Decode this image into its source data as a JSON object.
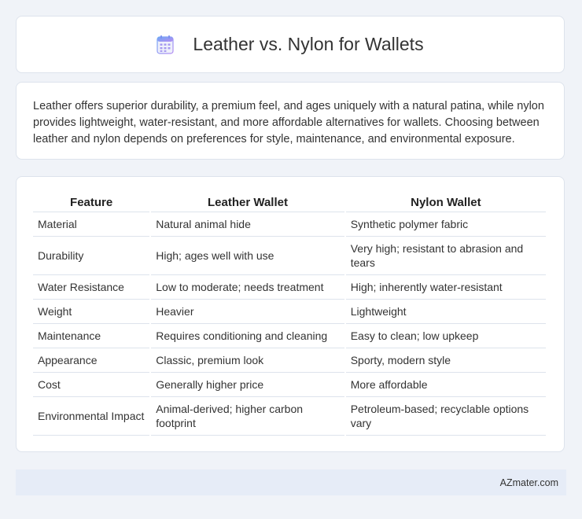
{
  "header": {
    "title": "Leather vs. Nylon for Wallets",
    "icon": "calendar-icon"
  },
  "description": "Leather offers superior durability, a premium feel, and ages uniquely with a natural patina, while nylon provides lightweight, water-resistant, and more affordable alternatives for wallets. Choosing between leather and nylon depends on preferences for style, maintenance, and environmental exposure.",
  "table": {
    "headers": [
      "Feature",
      "Leather Wallet",
      "Nylon Wallet"
    ],
    "rows": [
      [
        "Material",
        "Natural animal hide",
        "Synthetic polymer fabric"
      ],
      [
        "Durability",
        "High; ages well with use",
        "Very high; resistant to abrasion and tears"
      ],
      [
        "Water Resistance",
        "Low to moderate; needs treatment",
        "High; inherently water-resistant"
      ],
      [
        "Weight",
        "Heavier",
        "Lightweight"
      ],
      [
        "Maintenance",
        "Requires conditioning and cleaning",
        "Easy to clean; low upkeep"
      ],
      [
        "Appearance",
        "Classic, premium look",
        "Sporty, modern style"
      ],
      [
        "Cost",
        "Generally higher price",
        "More affordable"
      ],
      [
        "Environmental Impact",
        "Animal-derived; higher carbon footprint",
        "Petroleum-based; recyclable options vary"
      ]
    ]
  },
  "footer": {
    "source": "AZmater.com"
  },
  "colors": {
    "page_bg": "#f0f3f8",
    "card_bg": "#ffffff",
    "footer_bg": "#e6ecf7",
    "icon_accent": "#7b8ff0"
  }
}
